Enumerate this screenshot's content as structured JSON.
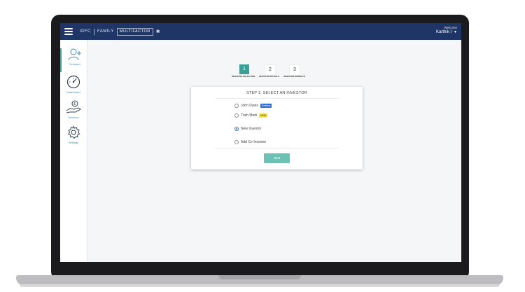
{
  "header": {
    "brand_left": "IDFC",
    "brand_mid": "FAMILY",
    "brand_logo_text": "MULTIFACTOR",
    "welcome_label": "Welcome",
    "user_name": "Karthik I",
    "menu_icon": "hamburger-icon",
    "caret_icon": "chevron-down-icon",
    "color": "#1f3566"
  },
  "sidebar": {
    "items": [
      {
        "label": "Onboard",
        "icon": "add-user-icon",
        "active": true
      },
      {
        "label": "Dashboard",
        "icon": "gauge-icon",
        "active": false
      },
      {
        "label": "Advisory",
        "icon": "money-hand-icon",
        "active": false
      },
      {
        "label": "Settings",
        "icon": "gear-icon",
        "active": false
      }
    ],
    "accent": "#4aa7a0"
  },
  "stepper": {
    "steps": [
      {
        "number": "1",
        "label": "INVESTOR SELECTION",
        "active": true
      },
      {
        "number": "2",
        "label": "INVESTOR DETAILS",
        "active": false
      },
      {
        "number": "3",
        "label": "INVESTOR MANDATE",
        "active": false
      }
    ]
  },
  "card": {
    "title": "STEP 1: SELECT AN INVESTOR",
    "options": [
      {
        "label": "John Davis",
        "tag": "Existing",
        "tag_color": "#2f6fd0",
        "checked": false
      },
      {
        "label": "Tush Modi",
        "tag": "NEW",
        "tag_color": "#f5e04a",
        "checked": false
      },
      {
        "label": "New Investor",
        "tag": "",
        "checked": true
      },
      {
        "label": "Add Co-Investor",
        "tag": "",
        "checked": false
      }
    ],
    "next_label": "Next",
    "button_color": "#6cc1b5"
  }
}
